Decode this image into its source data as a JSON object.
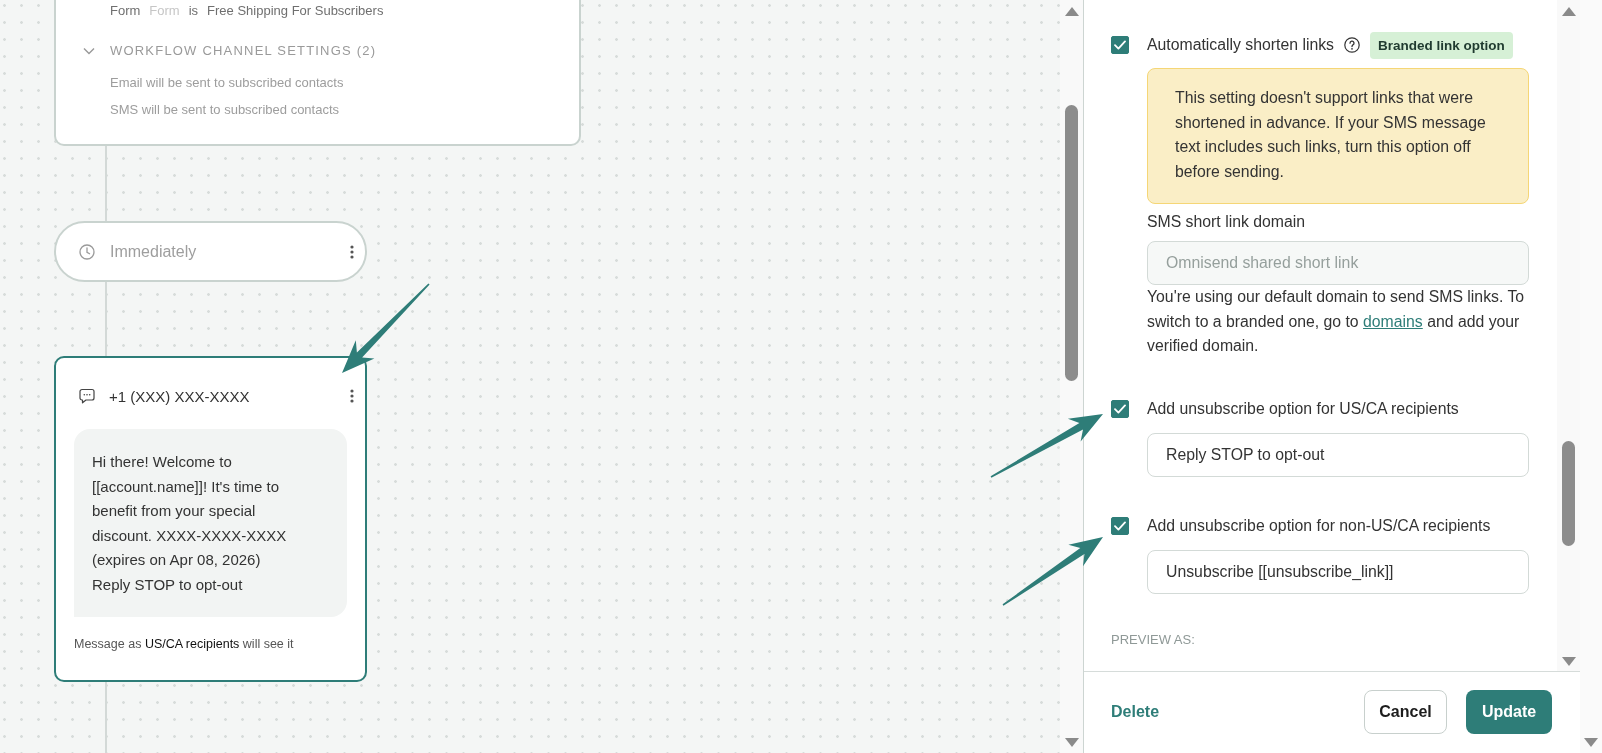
{
  "trigger_card": {
    "selected": false,
    "condition": {
      "field": "Form",
      "type": "Form",
      "operator": "is",
      "value": "Free Shipping For Subscribers"
    },
    "channel_settings": {
      "title": "WORKFLOW CHANNEL SETTINGS (2)",
      "expanded": true,
      "lines": [
        "Email will be sent to subscribed contacts",
        "SMS will be sent to subscribed contacts"
      ]
    }
  },
  "delay_node": {
    "selected": false,
    "label": "Immediately"
  },
  "sms_node": {
    "selected": true,
    "phone": "+1 (XXX) XXX-XXXX",
    "message": "Hi there! Welcome to [[account.name]]! It's time to benefit from your special discount. XXXX-XXXX-XXXX (expires on Apr 08, 2026)\nReply STOP to opt-out",
    "caption": "Message as **US/CA recipients** will see it"
  },
  "settings_panel": {
    "shorten_links": {
      "label": "Automatically shorten links",
      "checked": true,
      "badge": "Branded link option",
      "warning": "This setting doesn't support links that were shortened in advance. If your SMS message text includes such links, turn this option off before sending.",
      "domain_label": "SMS short link domain",
      "domain_field": {
        "placeholder": "Omnisend shared short link",
        "disabled": true
      },
      "domain_help": {
        "text_before": "You're using our default domain to send SMS links. To switch to a branded one, go to",
        "link": "domains",
        "text_after": "and add your verified domain."
      }
    },
    "unsubscribe_options": [
      {
        "label": "Add unsubscribe option for US/CA recipients",
        "checked": true,
        "value": "Reply STOP to opt-out"
      },
      {
        "label": "Add unsubscribe option for non-US/CA recipients",
        "checked": true,
        "value": "Unsubscribe [[unsubscribe_link]]"
      }
    ],
    "preview_label": "PREVIEW AS:"
  },
  "footer": {
    "delete": "Delete",
    "cancel": "Cancel",
    "update": "Update"
  }
}
